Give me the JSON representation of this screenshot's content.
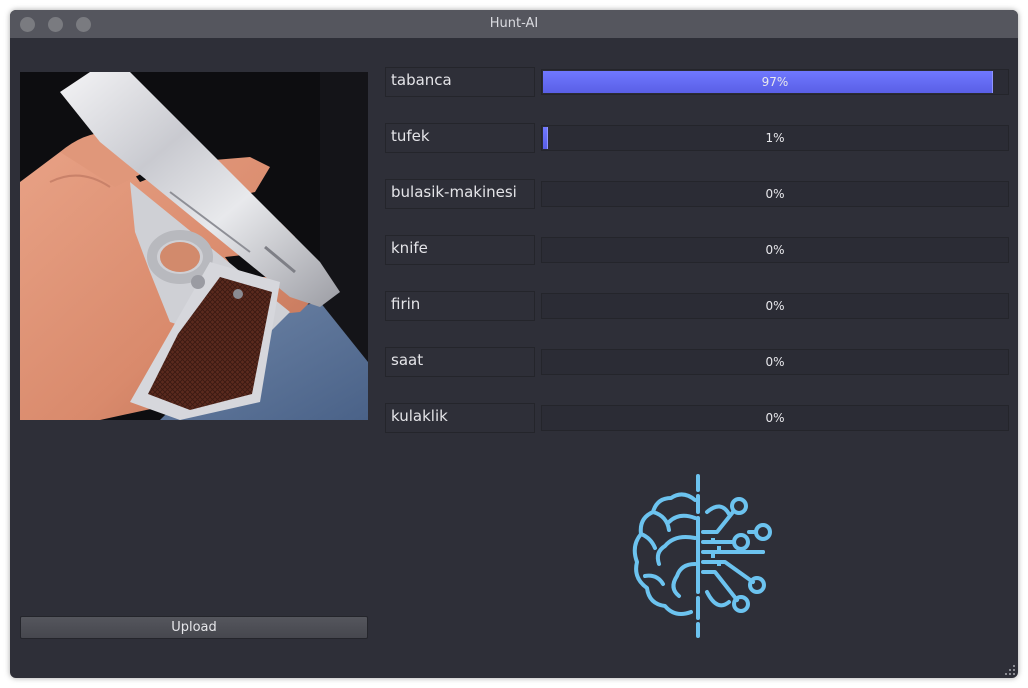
{
  "window": {
    "title": "Hunt-AI"
  },
  "preview": {
    "description": "hand holding silver pistol"
  },
  "upload": {
    "label": "Upload"
  },
  "predictions": [
    {
      "label": "tabanca",
      "percent": 97,
      "text": "97%"
    },
    {
      "label": "tufek",
      "percent": 1,
      "text": "1%"
    },
    {
      "label": "bulasik-makinesi",
      "percent": 0,
      "text": "0%"
    },
    {
      "label": "knife",
      "percent": 0,
      "text": "0%"
    },
    {
      "label": "firin",
      "percent": 0,
      "text": "0%"
    },
    {
      "label": "saat",
      "percent": 0,
      "text": "0%"
    },
    {
      "label": "kulaklik",
      "percent": 0,
      "text": "0%"
    }
  ],
  "logo": {
    "icon": "ai-brain-circuit-icon",
    "color": "#6cc3ef"
  },
  "colors": {
    "accent": "#6268f2",
    "background": "#2e2f38"
  }
}
